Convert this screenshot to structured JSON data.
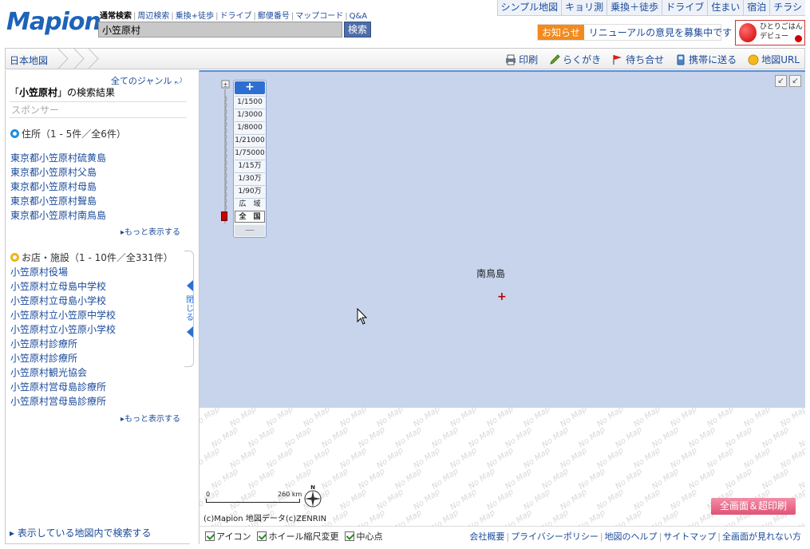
{
  "header": {
    "logo": "Mapion",
    "search_tabs": [
      "通常検索",
      "周辺検索",
      "乗換+徒歩",
      "ドライブ",
      "郵便番号",
      "マップコード",
      "Q&A"
    ],
    "search_value": "小笠原村",
    "search_button": "検索",
    "top_nav": [
      "シンプル地図",
      "キョリ測",
      "乗換＋徒歩",
      "ドライブ",
      "住まい",
      "宿泊",
      "チラシ"
    ],
    "notice_badge": "お知らせ",
    "notice_text": "リニューアルの意見を募集中です",
    "banner_text": "ひとりごはん デビュー"
  },
  "toolbar": {
    "breadcrumb": "日本地図",
    "tools": [
      "印刷",
      "らくがき",
      "待ち合せ",
      "携帯に送る",
      "地図URL"
    ]
  },
  "sidebar": {
    "all_genre": "全てのジャンル",
    "result_query": "小笠原村",
    "result_suffix": "の検索結果",
    "sponsor": "スポンサー",
    "address_head": "住所（1 - 5件／全6件）",
    "addresses": [
      "東京都小笠原村硫黄島",
      "東京都小笠原村父島",
      "東京都小笠原村母島",
      "東京都小笠原村聟島",
      "東京都小笠原村南鳥島"
    ],
    "more1": "もっと表示する",
    "shop_head": "お店・施設（1 - 10件／全331件）",
    "shops": [
      "小笠原村役場",
      "小笠原村立母島中学校",
      "小笠原村立母島小学校",
      "小笠原村立小笠原中学校",
      "小笠原村立小笠原小学校",
      "小笠原村診療所",
      "小笠原村診療所",
      "小笠原村観光協会",
      "小笠原村営母島診療所",
      "小笠原村営母島診療所"
    ],
    "more2": "もっと表示する",
    "search_in_map": "表示している地図内で検索する",
    "close_tab": "閉じる"
  },
  "map": {
    "place_label": "南鳥島",
    "zoom_levels": [
      "1/1500",
      "1/3000",
      "1/8000",
      "1/21000",
      "1/75000",
      "1/15万",
      "1/30万",
      "1/90万",
      "広　域",
      "全　国"
    ],
    "zoom_active": "全　国",
    "scale_zero": "0",
    "scale_km": "260 km",
    "compass_n": "N",
    "copyright": "(c)Mapion 地図データ(c)ZENRIN",
    "print_button": "全画面＆超印刷",
    "no_map": "No Map",
    "options": [
      "アイコン",
      "ホイール縮尺変更",
      "中心点"
    ],
    "footer_links": [
      "会社概要",
      "プライバシーポリシー",
      "地図のヘルプ",
      "サイトマップ",
      "全画面が見れない方"
    ]
  },
  "colors": {
    "brand": "#1e63b8",
    "map_sea": "#c7d4ec",
    "accent_orange": "#f28a1e",
    "print_pink": "#e05276"
  }
}
